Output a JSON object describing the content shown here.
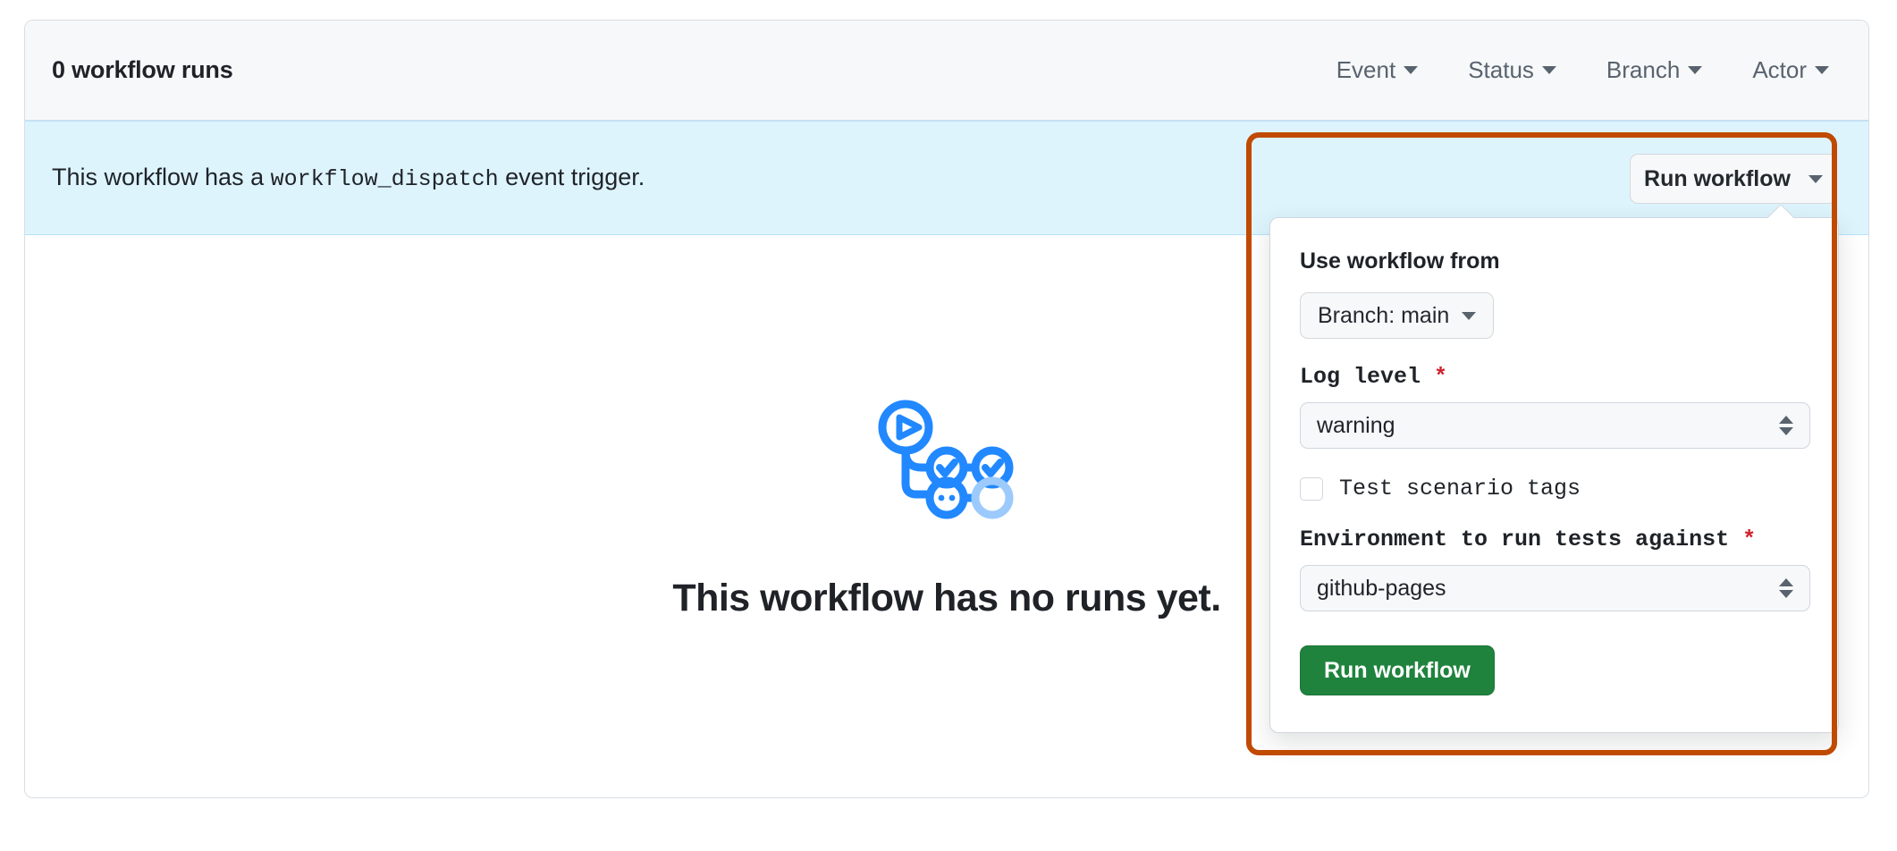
{
  "header": {
    "runs_count_label": "0 workflow runs",
    "filters": [
      {
        "label": "Event",
        "icon": "chevron-down-icon"
      },
      {
        "label": "Status",
        "icon": "chevron-down-icon"
      },
      {
        "label": "Branch",
        "icon": "chevron-down-icon"
      },
      {
        "label": "Actor",
        "icon": "chevron-down-icon"
      }
    ]
  },
  "banner": {
    "text_before": "This workflow has a ",
    "code": "workflow_dispatch",
    "text_after": " event trigger.",
    "background_color": "#ddf4fd",
    "border_color": "#b6e3ff"
  },
  "run_workflow_button": {
    "label": "Run workflow",
    "icon": "chevron-down-icon"
  },
  "dispatch_panel": {
    "heading": "Use workflow from",
    "branch_selector": {
      "label": "Branch: main",
      "icon": "chevron-down-icon"
    },
    "inputs": [
      {
        "name": "log-level",
        "label": "Log level",
        "required_marker": "*",
        "type": "select",
        "value": "warning"
      },
      {
        "name": "test-scenario-tags",
        "label": "Test scenario tags",
        "type": "checkbox",
        "checked": false
      },
      {
        "name": "environment",
        "label": "Environment to run tests against",
        "required_marker": "*",
        "type": "select",
        "value": "github-pages"
      }
    ],
    "submit_label": "Run workflow",
    "submit_color": "#1f833d"
  },
  "empty_state": {
    "title": "This workflow has no runs yet.",
    "illustration": "workflow-graph-illustration",
    "illustration_color": "#2188ff",
    "illustration_muted_color": "#9ccafc"
  },
  "annotation": {
    "name": "orange-highlight-box",
    "color": "#c04a00"
  }
}
